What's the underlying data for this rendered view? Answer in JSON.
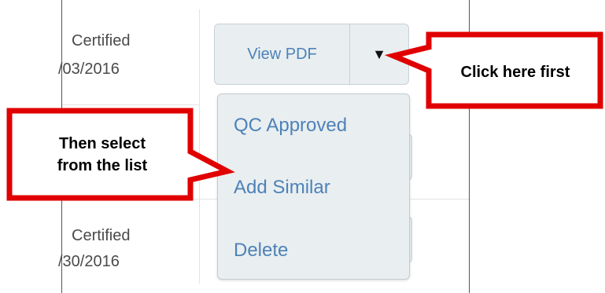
{
  "rows": [
    {
      "status": "Certified",
      "date": "/03/2016"
    },
    {
      "status": "Certified",
      "date": "/30/2016"
    }
  ],
  "button_group": {
    "view_pdf_label": "View PDF",
    "caret_glyph": "▼"
  },
  "dropdown_menu": {
    "items": [
      "QC Approved",
      "Add Similar",
      "Delete"
    ]
  },
  "callouts": {
    "first": "Click here first",
    "second_line1": "Then select",
    "second_line2": "from the list"
  },
  "colors": {
    "callout_border": "#e00000",
    "link": "#4d82b8",
    "button_bg": "#e9eef0"
  }
}
